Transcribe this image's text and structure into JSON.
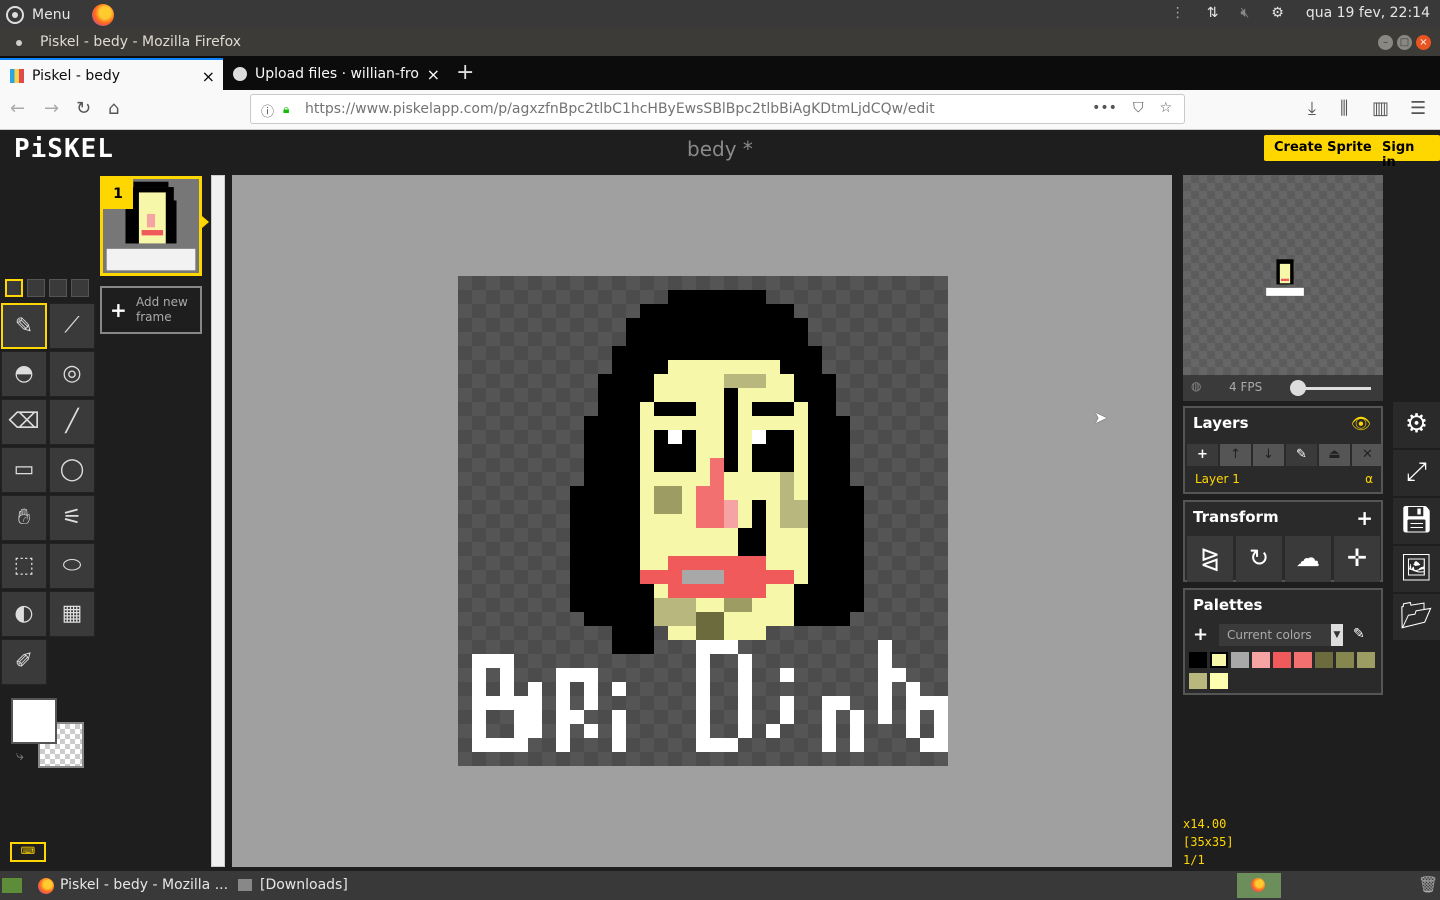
{
  "os": {
    "menu_label": "Menu",
    "clock": "qua 19 fev, 22:14",
    "icons": [
      "network-icon",
      "volume-muted-icon",
      "settings-icon"
    ]
  },
  "window": {
    "title": "Piskel - bedy - Mozilla Firefox"
  },
  "tabs": [
    {
      "label": "Piskel - bedy",
      "active": true
    },
    {
      "label": "Upload files · willian-fro",
      "active": false
    }
  ],
  "nav": {
    "url": "https://www.piskelapp.com/p/agxzfnBpc2tlbC1hcHByEwsSBlBpc2tlbBiAgKDtmLjdCQw/edit"
  },
  "piskel": {
    "logo": "PiSKEL",
    "title": "bedy *",
    "create_sprite": "Create Sprite",
    "sign_in": "Sign in",
    "frame_number": "1",
    "add_frame": "Add new frame"
  },
  "preview": {
    "fps": "4 FPS",
    "fps_level": 0.1
  },
  "layers": {
    "title": "Layers",
    "items": [
      {
        "name": "Layer 1",
        "alpha": "α"
      }
    ]
  },
  "transform": {
    "title": "Transform"
  },
  "palettes": {
    "title": "Palettes",
    "selected": "Current colors",
    "colors": [
      "#000000",
      "#f7f7aa",
      "#a8a8a8",
      "#f5a3a3",
      "#f05a5a",
      "#f37070",
      "#6b6b3e",
      "#86864f",
      "#9c9c63",
      "#b7b77e",
      "#ffffb0"
    ]
  },
  "status": {
    "zoom": "x14.00",
    "size": "[35x35]",
    "frames": "1/1"
  },
  "taskbar": {
    "items": [
      "Piskel - bedy - Mozilla ...",
      "[Downloads]"
    ]
  },
  "colors": {
    "accent": "#ffd700",
    "primary_color": "#ffffff"
  }
}
